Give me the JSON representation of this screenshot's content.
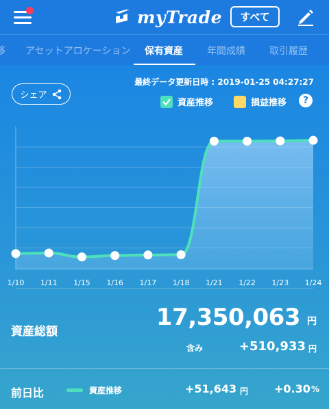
{
  "header": {
    "brand": "myTrade",
    "all_button": "すべて"
  },
  "tabs": [
    {
      "label": "移"
    },
    {
      "label": "アセットアロケーション"
    },
    {
      "label": "保有資産",
      "active": true
    },
    {
      "label": "年間成績"
    },
    {
      "label": "取引履歴"
    }
  ],
  "update": {
    "label": "最終データ更新日時 : 2019-01-25 04:27:27"
  },
  "share_button": "シェア",
  "legend": {
    "asset": {
      "label": "資産推移",
      "color": "#4ee0bc",
      "checked": true
    },
    "pnl": {
      "label": "損益推移",
      "color": "#ffd966",
      "checked": false
    }
  },
  "icons": {
    "menu": "hamburger-icon",
    "brand": "mytrade-logo-icon",
    "edit": "pencil-icon",
    "share": "share-icon",
    "help": "question-icon"
  },
  "chart_data": {
    "type": "line",
    "categories": [
      "1/10",
      "1/11",
      "1/15",
      "1/16",
      "1/17",
      "1/18",
      "1/21",
      "1/22",
      "1/23",
      "1/24"
    ],
    "series": [
      {
        "name": "資産推移",
        "values": [
          16940000,
          16942000,
          16928000,
          16933000,
          16935000,
          16936000,
          17347000,
          17347000,
          17348000,
          17350063
        ]
      }
    ],
    "ylim": [
      16880000,
      17400000
    ],
    "grid": true,
    "color": "#4ee0bc"
  },
  "summary": {
    "total_label": "資産総額",
    "total_value": "17,350,063",
    "unit": "円",
    "incl_label": "含み",
    "incl_value": "+510,933"
  },
  "daily": {
    "label": "前日比",
    "series_label": "資産推移",
    "change_value": "+51,643",
    "change_pct": "+0.30",
    "pct_unit": "%"
  }
}
